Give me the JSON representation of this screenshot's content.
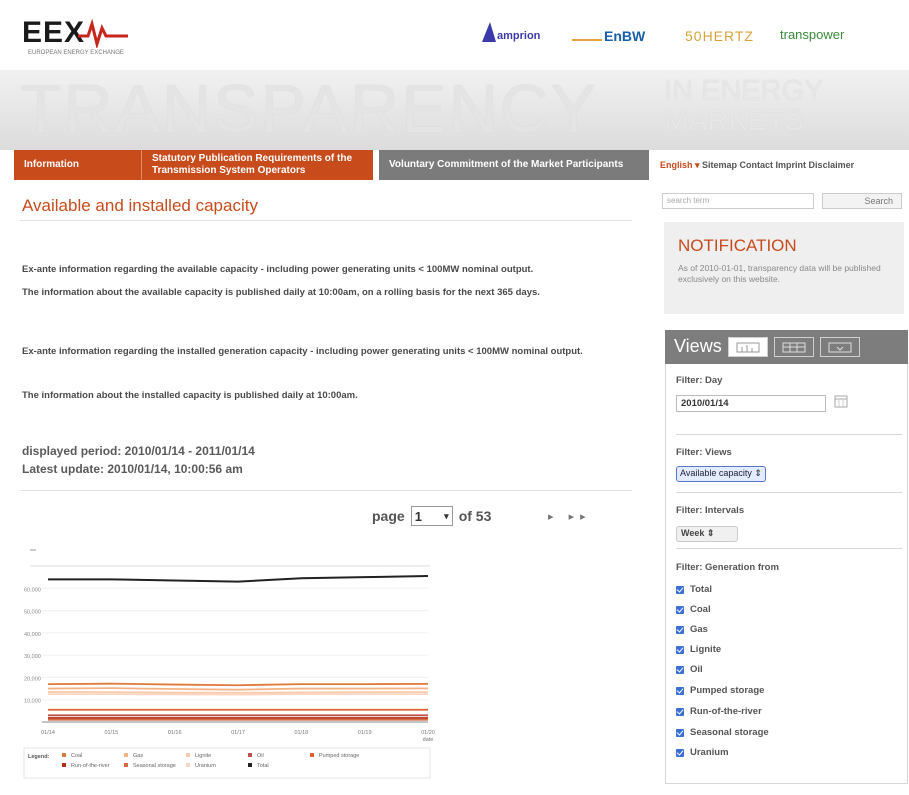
{
  "header": {
    "logo": "EEX",
    "logo_sub": "EUROPEAN ENERGY EXCHANGE",
    "partners": [
      "amprion",
      "EnBW",
      "50HERTZ",
      "transpower"
    ],
    "banner_big": "TRANSPARENCY",
    "banner_small": "IN ENERGY MARKETS"
  },
  "nav": {
    "items": [
      "Information",
      "Statutory Publication Requirements of the Transmission System Operators",
      "Voluntary Commitment of the Market Participants"
    ],
    "language": "English ▾",
    "links": "Sitemap  Contact  Imprint  Disclaimer"
  },
  "main": {
    "title": "Available and installed capacity",
    "paragraphs": [
      "Ex-ante information regarding the available capacity - including power generating units < 100MW nominal output.",
      "The information about the available capacity is published daily at 10:00am, on a rolling basis for the next 365 days.",
      "Ex-ante information regarding the installed generation capacity - including power generating units < 100MW nominal output.",
      "The information about the installed capacity is published daily at 10:00am."
    ],
    "displayed_period": "displayed period: 2010/01/14 - 2011/01/14",
    "latest_update": "Latest update: 2010/01/14, 10:00:56 am",
    "pager": {
      "label": "page",
      "current": "1",
      "of": "of 53",
      "arrows": "▸ ▸▸"
    }
  },
  "sidebar": {
    "search_placeholder": "search term",
    "search_button": "Search",
    "notification_title": "NOTIFICATION",
    "notification_text": "As of 2010-01-01, transparency data will be published exclusively on this website.",
    "views_title": "Views",
    "filter_day_label": "Filter: Day",
    "filter_day_value": "2010/01/14",
    "filter_views_label": "Filter: Views",
    "filter_views_value": "Available capacity ⇕",
    "filter_intervals_label": "Filter: Intervals",
    "filter_intervals_value": "Week ⇕",
    "filter_generation_label": "Filter: Generation from",
    "generation_options": [
      "Total",
      "Coal",
      "Gas",
      "Lignite",
      "Oil",
      "Pumped storage",
      "Run-of-the-river",
      "Seasonal storage",
      "Uranium"
    ]
  },
  "chart_data": {
    "type": "line",
    "x": [
      "01/14",
      "01/15",
      "01/16",
      "01/17",
      "01/18",
      "01/19",
      "01/20"
    ],
    "xlabel_last": "date",
    "y_ticks": [
      "60,000",
      "50,000",
      "40,000",
      "30,000",
      "20,000",
      "10,000"
    ],
    "ylim": [
      0,
      70000
    ],
    "legend_label": "Legend:",
    "series": [
      {
        "name": "Total",
        "color": "#222222",
        "values": [
          64000,
          64000,
          63500,
          63000,
          64500,
          65000,
          65500
        ]
      },
      {
        "name": "Coal",
        "color": "#e07a3a",
        "values": [
          17000,
          17200,
          16800,
          16500,
          17000,
          17000,
          17100
        ]
      },
      {
        "name": "Gas",
        "color": "#f4b183",
        "values": [
          15000,
          15200,
          14800,
          14500,
          15000,
          15000,
          15100
        ]
      },
      {
        "name": "Lignite",
        "color": "#f8cbad",
        "values": [
          13500,
          13400,
          13200,
          13100,
          13300,
          13400,
          13400
        ]
      },
      {
        "name": "Oil",
        "color": "#c0504d",
        "values": [
          3000,
          3000,
          3000,
          3000,
          3000,
          3000,
          3000
        ]
      },
      {
        "name": "Pumped storage",
        "color": "#e06030",
        "values": [
          5500,
          5500,
          5500,
          5500,
          5500,
          5500,
          5500
        ]
      },
      {
        "name": "Run-of-the-river",
        "color": "#b03010",
        "values": [
          1800,
          1800,
          1800,
          1800,
          1800,
          1800,
          1800
        ]
      },
      {
        "name": "Seasonal storage",
        "color": "#d86a40",
        "values": [
          1000,
          1000,
          1000,
          1000,
          1000,
          1000,
          1000
        ]
      },
      {
        "name": "Uranium",
        "color": "#fbd5c0",
        "values": [
          12500,
          12500,
          12400,
          12300,
          12500,
          12500,
          12500
        ]
      }
    ]
  }
}
